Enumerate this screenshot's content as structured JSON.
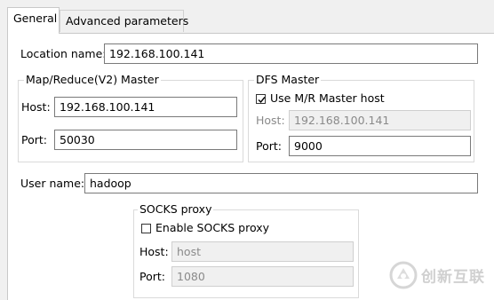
{
  "tabs": [
    {
      "label": "General",
      "active": true
    },
    {
      "label": "Advanced parameters",
      "active": false
    }
  ],
  "location": {
    "label": "Location name:",
    "value": "192.168.100.141"
  },
  "mr_master": {
    "title": "Map/Reduce(V2) Master",
    "host_label": "Host:",
    "host_value": "192.168.100.141",
    "port_label": "Port:",
    "port_value": "50030"
  },
  "dfs_master": {
    "title": "DFS Master",
    "use_mr_label": "Use M/R Master host",
    "use_mr_checked": true,
    "host_label": "Host:",
    "host_value": "192.168.100.141",
    "port_label": "Port:",
    "port_value": "9000"
  },
  "user": {
    "label": "User name:",
    "value": "hadoop"
  },
  "socks": {
    "title": "SOCKS proxy",
    "enable_label": "Enable SOCKS proxy",
    "enable_checked": false,
    "host_label": "Host:",
    "host_value": "host",
    "port_label": "Port:",
    "port_value": "1080"
  },
  "watermark": {
    "text": "创新互联",
    "icon": "brand-logo-icon"
  },
  "colors": {
    "watermark": "#c8c8c8"
  }
}
